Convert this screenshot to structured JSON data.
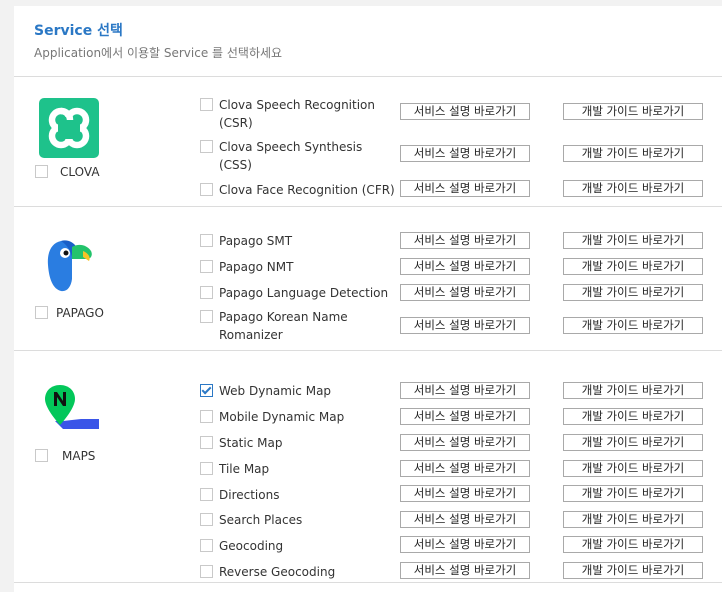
{
  "header": {
    "title": "Service 선택",
    "subtitle": "Application에서 이용할 Service 를 선택하세요"
  },
  "sections": [
    {
      "name": "CLOVA",
      "logo_icon": "clova-logo",
      "checked": false,
      "services": [
        {
          "label": "Clova Speech Recognition (CSR)",
          "checked": false,
          "desc_button": "서비스 설명 바로가기",
          "guide_button": "개발 가이드 바로가기"
        },
        {
          "label": "Clova Speech Synthesis (CSS)",
          "checked": false,
          "desc_button": "서비스 설명 바로가기",
          "guide_button": "개발 가이드 바로가기"
        },
        {
          "label": "Clova Face Recognition (CFR)",
          "checked": false,
          "desc_button": "서비스 설명 바로가기",
          "guide_button": "개발 가이드 바로가기"
        }
      ]
    },
    {
      "name": "PAPAGO",
      "logo_icon": "papago-parrot-logo",
      "checked": false,
      "services": [
        {
          "label": "Papago SMT",
          "checked": false,
          "desc_button": "서비스 설명 바로가기",
          "guide_button": "개발 가이드 바로가기"
        },
        {
          "label": "Papago NMT",
          "checked": false,
          "desc_button": "서비스 설명 바로가기",
          "guide_button": "개발 가이드 바로가기"
        },
        {
          "label": "Papago Language Detection",
          "checked": false,
          "desc_button": "서비스 설명 바로가기",
          "guide_button": "개발 가이드 바로가기"
        },
        {
          "label": "Papago Korean Name Romanizer",
          "checked": false,
          "desc_button": "서비스 설명 바로가기",
          "guide_button": "개발 가이드 바로가기"
        }
      ]
    },
    {
      "name": "MAPS",
      "logo_icon": "naver-maps-pin-logo",
      "checked": false,
      "services": [
        {
          "label": "Web Dynamic Map",
          "checked": true,
          "desc_button": "서비스 설명 바로가기",
          "guide_button": "개발 가이드 바로가기"
        },
        {
          "label": "Mobile Dynamic Map",
          "checked": false,
          "desc_button": "서비스 설명 바로가기",
          "guide_button": "개발 가이드 바로가기"
        },
        {
          "label": "Static Map",
          "checked": false,
          "desc_button": "서비스 설명 바로가기",
          "guide_button": "개발 가이드 바로가기"
        },
        {
          "label": "Tile Map",
          "checked": false,
          "desc_button": "서비스 설명 바로가기",
          "guide_button": "개발 가이드 바로가기"
        },
        {
          "label": "Directions",
          "checked": false,
          "desc_button": "서비스 설명 바로가기",
          "guide_button": "개발 가이드 바로가기"
        },
        {
          "label": "Search Places",
          "checked": false,
          "desc_button": "서비스 설명 바로가기",
          "guide_button": "개발 가이드 바로가기"
        },
        {
          "label": "Geocoding",
          "checked": false,
          "desc_button": "서비스 설명 바로가기",
          "guide_button": "개발 가이드 바로가기"
        },
        {
          "label": "Reverse Geocoding",
          "checked": false,
          "desc_button": "서비스 설명 바로가기",
          "guide_button": "개발 가이드 바로가기"
        }
      ]
    }
  ],
  "colors": {
    "accent": "#2b78c5",
    "clova_green": "#1ec28b",
    "papago_blue": "#2a7de1",
    "maps_green": "#03c75a"
  }
}
